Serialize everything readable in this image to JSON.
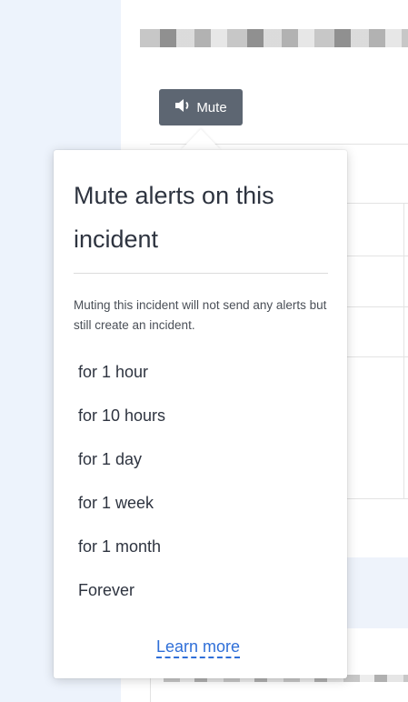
{
  "colors": {
    "accent": "#2f6fd8",
    "button_bg": "#5d6672",
    "sidebar_bg": "#edf3fc"
  },
  "toolbar": {
    "mute_label": "Mute",
    "mute_icon": "speaker-mute-icon"
  },
  "popover": {
    "title": "Mute alerts on this incident",
    "description": "Muting this incident will not send any alerts but still create an incident.",
    "options": [
      "for 1 hour",
      "for 10 hours",
      "for 1 day",
      "for 1 week",
      "for 1 month",
      "Forever"
    ],
    "learn_more": "Learn more"
  }
}
